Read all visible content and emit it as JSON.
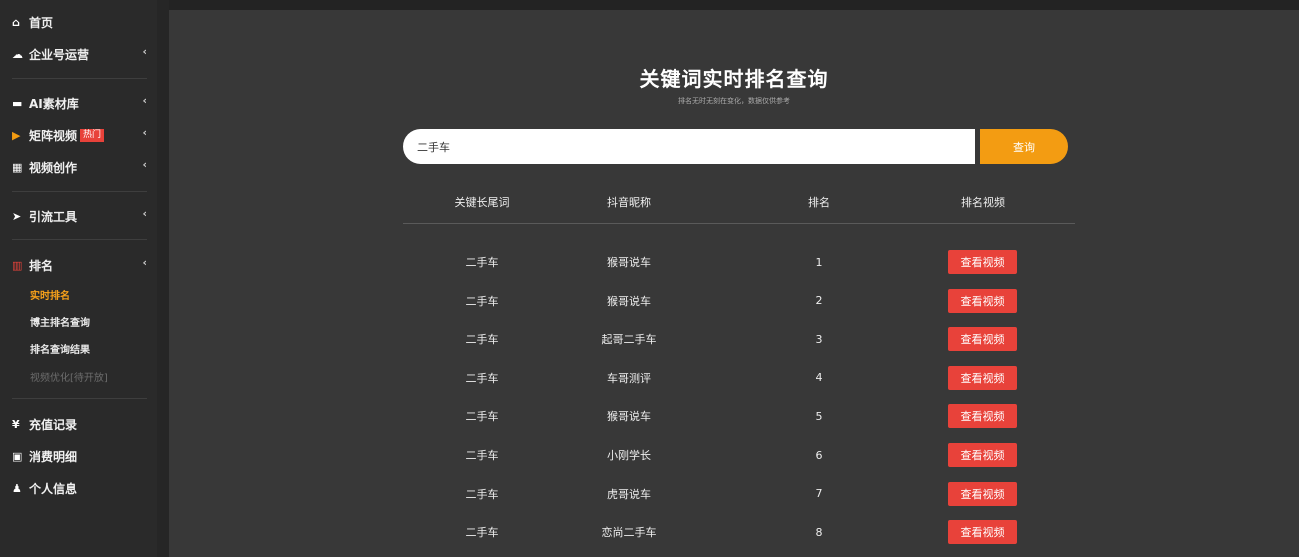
{
  "sidebar": {
    "items": [
      {
        "icon": "home-icon",
        "glyph": "⌂",
        "label": "首页",
        "arrow": false
      },
      {
        "icon": "cloud-icon",
        "glyph": "☁",
        "label": "企业号运营",
        "arrow": true
      },
      {
        "icon": "folder-icon",
        "glyph": "▬",
        "label": "AI素材库",
        "arrow": true
      },
      {
        "icon": "video-icon",
        "glyph": "▶",
        "label": "矩阵视频",
        "arrow": true,
        "badge": "热门"
      },
      {
        "icon": "film-icon",
        "glyph": "▦",
        "label": "视频创作",
        "arrow": true
      },
      {
        "icon": "send-icon",
        "glyph": "➤",
        "label": "引流工具",
        "arrow": true
      },
      {
        "icon": "chart-icon",
        "glyph": "▥",
        "label": "排名",
        "arrow": true
      },
      {
        "icon": "yen-icon",
        "glyph": "¥",
        "label": "充值记录",
        "arrow": false
      },
      {
        "icon": "money-icon",
        "glyph": "▣",
        "label": "消费明细",
        "arrow": false
      },
      {
        "icon": "user-icon",
        "glyph": "♟",
        "label": "个人信息",
        "arrow": false
      }
    ],
    "arrow_glyph": "‹",
    "sub_items": [
      {
        "label": "实时排名",
        "state": "active"
      },
      {
        "label": "博主排名查询",
        "state": "normal"
      },
      {
        "label": "排名查询结果",
        "state": "normal"
      },
      {
        "label": "视频优化[待开放]",
        "state": "disabled"
      }
    ]
  },
  "main": {
    "title": "关键词实时排名查询",
    "subtitle": "排名无时无刻在变化，数据仅供参考",
    "search": {
      "value": "二手车",
      "button_label": "查询"
    },
    "table": {
      "headers": [
        "关键长尾词",
        "抖音昵称",
        "排名",
        "排名视频"
      ],
      "rows": [
        {
          "keyword": "二手车",
          "nickname": "猴哥说车",
          "rank": "1",
          "action": "查看视频"
        },
        {
          "keyword": "二手车",
          "nickname": "猴哥说车",
          "rank": "2",
          "action": "查看视频"
        },
        {
          "keyword": "二手车",
          "nickname": "起哥二手车",
          "rank": "3",
          "action": "查看视频"
        },
        {
          "keyword": "二手车",
          "nickname": "车哥测评",
          "rank": "4",
          "action": "查看视频"
        },
        {
          "keyword": "二手车",
          "nickname": "猴哥说车",
          "rank": "5",
          "action": "查看视频"
        },
        {
          "keyword": "二手车",
          "nickname": "小刚学长",
          "rank": "6",
          "action": "查看视频"
        },
        {
          "keyword": "二手车",
          "nickname": "虎哥说车",
          "rank": "7",
          "action": "查看视频"
        },
        {
          "keyword": "二手车",
          "nickname": "恋尚二手车",
          "rank": "8",
          "action": "查看视频"
        }
      ]
    }
  },
  "colors": {
    "accent": "#f39c12",
    "danger": "#e8423a",
    "active_sub": "#f6a01a"
  }
}
